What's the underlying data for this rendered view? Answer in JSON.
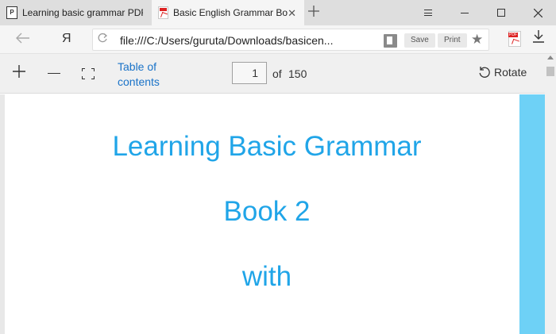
{
  "tabs": [
    {
      "title": "Learning basic grammar PDF",
      "favicon": "pdf-viewer-icon",
      "active": false
    },
    {
      "title": "Basic English Grammar Bo",
      "favicon": "pdf-file-icon",
      "active": true,
      "close": "✕"
    }
  ],
  "browser": {
    "new_tab_icon": "plus-icon",
    "yandex_logo": "Я",
    "url": "file:///C:/Users/guruta/Downloads/basicen...",
    "save_label": "Save",
    "print_label": "Print"
  },
  "pdf_toolbar": {
    "toc_label": "Table of contents",
    "current_page": "1",
    "of_label": "of",
    "total_pages": "150",
    "rotate_label": "Rotate"
  },
  "document": {
    "lines": [
      "Learning Basic Grammar",
      "Book 2",
      "with"
    ]
  },
  "colors": {
    "accent_blue": "#20a5e8",
    "side_band": "#6ed1f6",
    "link_blue": "#1a73c8"
  }
}
